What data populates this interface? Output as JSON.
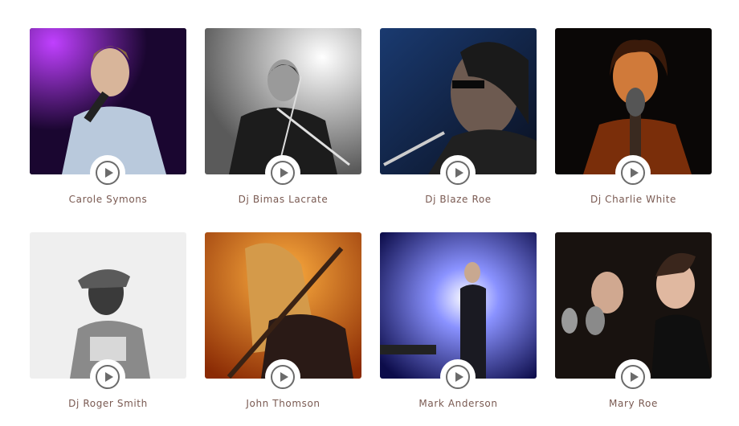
{
  "artists": [
    {
      "name": "Carole Symons",
      "palette": [
        "#2a0b4a",
        "#9a2fd6",
        "#d7c5b8"
      ]
    },
    {
      "name": "Dj Bimas Lacrate",
      "palette": [
        "#ededed",
        "#8e8e8e",
        "#1a1a1a"
      ]
    },
    {
      "name": "Dj Blaze Roe",
      "palette": [
        "#0e1f3d",
        "#3a3a3a",
        "#c8b4a4"
      ]
    },
    {
      "name": "Dj Charlie White",
      "palette": [
        "#0e0a08",
        "#b55a18",
        "#e0945a"
      ]
    },
    {
      "name": "Dj Roger Smith",
      "palette": [
        "#f2f2f2",
        "#cfcfcf",
        "#2d2d2d"
      ]
    },
    {
      "name": "John Thomson",
      "palette": [
        "#a83a08",
        "#f0a030",
        "#2a1a14"
      ]
    },
    {
      "name": "Mark Anderson",
      "palette": [
        "#0c0c4a",
        "#8a92ff",
        "#1a1a2a"
      ]
    },
    {
      "name": "Mary Roe",
      "palette": [
        "#1a1412",
        "#8a7a72",
        "#d9b09a"
      ]
    }
  ],
  "colors": {
    "name_text": "#7a5a52",
    "play_icon": "#6b6b6b"
  }
}
